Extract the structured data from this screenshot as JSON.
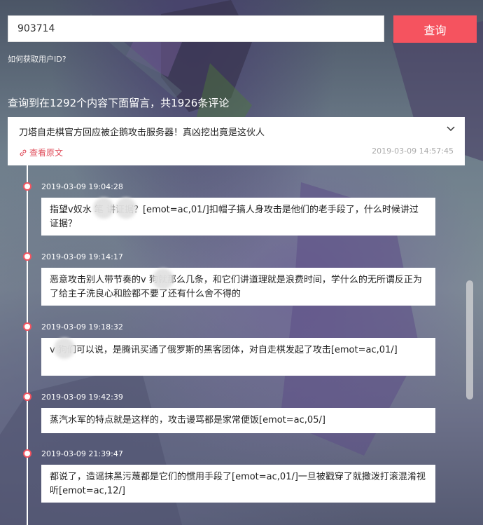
{
  "search": {
    "value": "903714",
    "button_label": "查询"
  },
  "help_link": "如何获取用户ID?",
  "summary": "查询到在1292个内容下面留言，共1926条评论",
  "card": {
    "title": "刀塔自走棋官方回应被企鹅攻击服务器！真凶挖出竟是这伙人",
    "view_original": "查看原文",
    "time": "2019-03-09 14:57:45",
    "icons": {
      "expand": "chevron-down-icon",
      "link": "link-icon"
    }
  },
  "comments": [
    {
      "time": "2019-03-09 19:04:28",
      "text": "指望v奴水  笔     讲证据？[emot=ac,01/]扣帽子搞人身攻击是他们的老手段了，什么时候讲过证据？"
    },
    {
      "time": "2019-03-09 19:14:17",
      "text": "恶意攻击别人带节奏的v     狗就那么几条，和它们讲道理就是浪费时间，学什么的无所谓反正为了给主子洗良心和脸都不要了还有什么舍不得的"
    },
    {
      "time": "2019-03-09 19:18:32",
      "text": "v     狗们可以说，是腾讯买通了俄罗斯的黑客团体，对自走棋发起了攻击[emot=ac,01/]"
    },
    {
      "time": "2019-03-09 19:42:39",
      "text": "蒸汽水军的特点就是这样的，攻击谩骂都是家常便饭[emot=ac,05/]"
    },
    {
      "time": "2019-03-09 21:39:47",
      "text": "都说了，造谣抹黑污蔑都是它们的惯用手段了[emot=ac,01/]一旦被戳穿了就撒泼打滚混淆视听[emot=ac,12/]"
    }
  ],
  "colors": {
    "accent": "#f5535f",
    "link": "#e0505e"
  }
}
